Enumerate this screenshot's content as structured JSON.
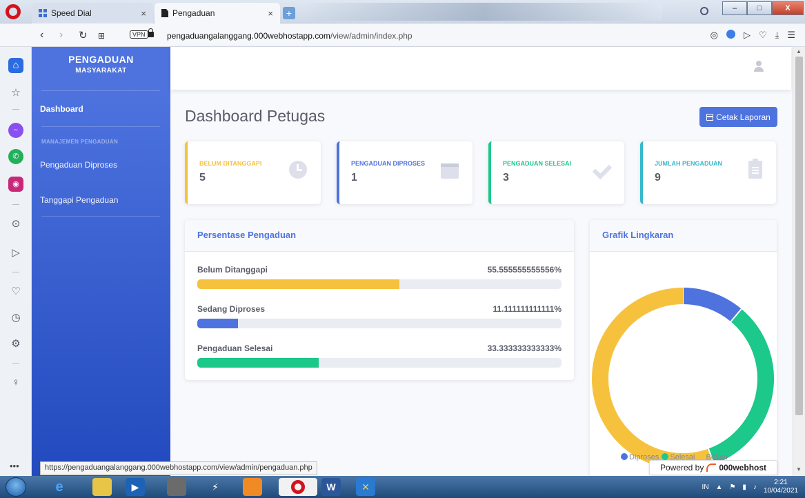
{
  "browser": {
    "tabs": [
      {
        "title": "Speed Dial"
      },
      {
        "title": "Pengaduan"
      }
    ],
    "tab_close_glyph": "×",
    "new_tab_glyph": "+",
    "vpn_label": "VPN",
    "url_domain": "pengaduangalanggang.000webhostapp.com",
    "url_path": "/view/admin/index.php",
    "status_url": "https://pengaduangalanggang.000webhostapp.com/view/admin/pengaduan.php",
    "window_buttons": [
      "–",
      "□",
      "X"
    ]
  },
  "app": {
    "brand_title": "PENGADUAN",
    "brand_subtitle": "MASYARAKAT",
    "nav": {
      "dashboard": "Dashboard",
      "section_heading": "MANAJEMEN PENGADUAN",
      "processed": "Pengaduan Diproses",
      "respond": "Tanggapi Pengaduan"
    },
    "page_title": "Dashboard Petugas",
    "report_button": "Cetak Laporan",
    "cards": [
      {
        "label": "BELUM DITANGGAPI",
        "value": "5",
        "color": "#f6c23e",
        "icon": "clock-icon"
      },
      {
        "label": "PENGADUAN DIPROSES",
        "value": "1",
        "color": "#4e73df",
        "icon": "calendar-icon"
      },
      {
        "label": "PENGADUAN SELESAI",
        "value": "3",
        "color": "#1cc88a",
        "icon": "check-icon"
      },
      {
        "label": "JUMLAH PENGADUAN",
        "value": "9",
        "color": "#36b9cc",
        "icon": "clipboard-icon"
      }
    ],
    "percentage_panel": {
      "title": "Persentase Pengaduan",
      "rows": [
        {
          "label": "Belum Ditanggapi",
          "pct_text": "55.555555555556%",
          "fraction": 0.5556,
          "color": "#f6c23e"
        },
        {
          "label": "Sedang Diproses",
          "pct_text": "11.111111111111%",
          "fraction": 0.1111,
          "color": "#4e73df"
        },
        {
          "label": "Pengaduan Selesai",
          "pct_text": "33.333333333333%",
          "fraction": 0.3333,
          "color": "#1cc88a"
        }
      ]
    },
    "chart_panel": {
      "title": "Grafik Lingkaran"
    },
    "powered_by": {
      "prefix": "Powered by",
      "brand": "000webhost"
    }
  },
  "chart_data": {
    "type": "pie",
    "subtype": "doughnut",
    "title": "Grafik Lingkaran",
    "categories": [
      "Diproses",
      "Selesai",
      "Belum"
    ],
    "values": [
      1,
      3,
      5
    ],
    "colors": [
      "#4e73df",
      "#1cc88a",
      "#f6c23e"
    ],
    "legend_position": "bottom"
  },
  "taskbar": {
    "lang": "IN",
    "time": "2:21",
    "date": "10/04/2021"
  }
}
